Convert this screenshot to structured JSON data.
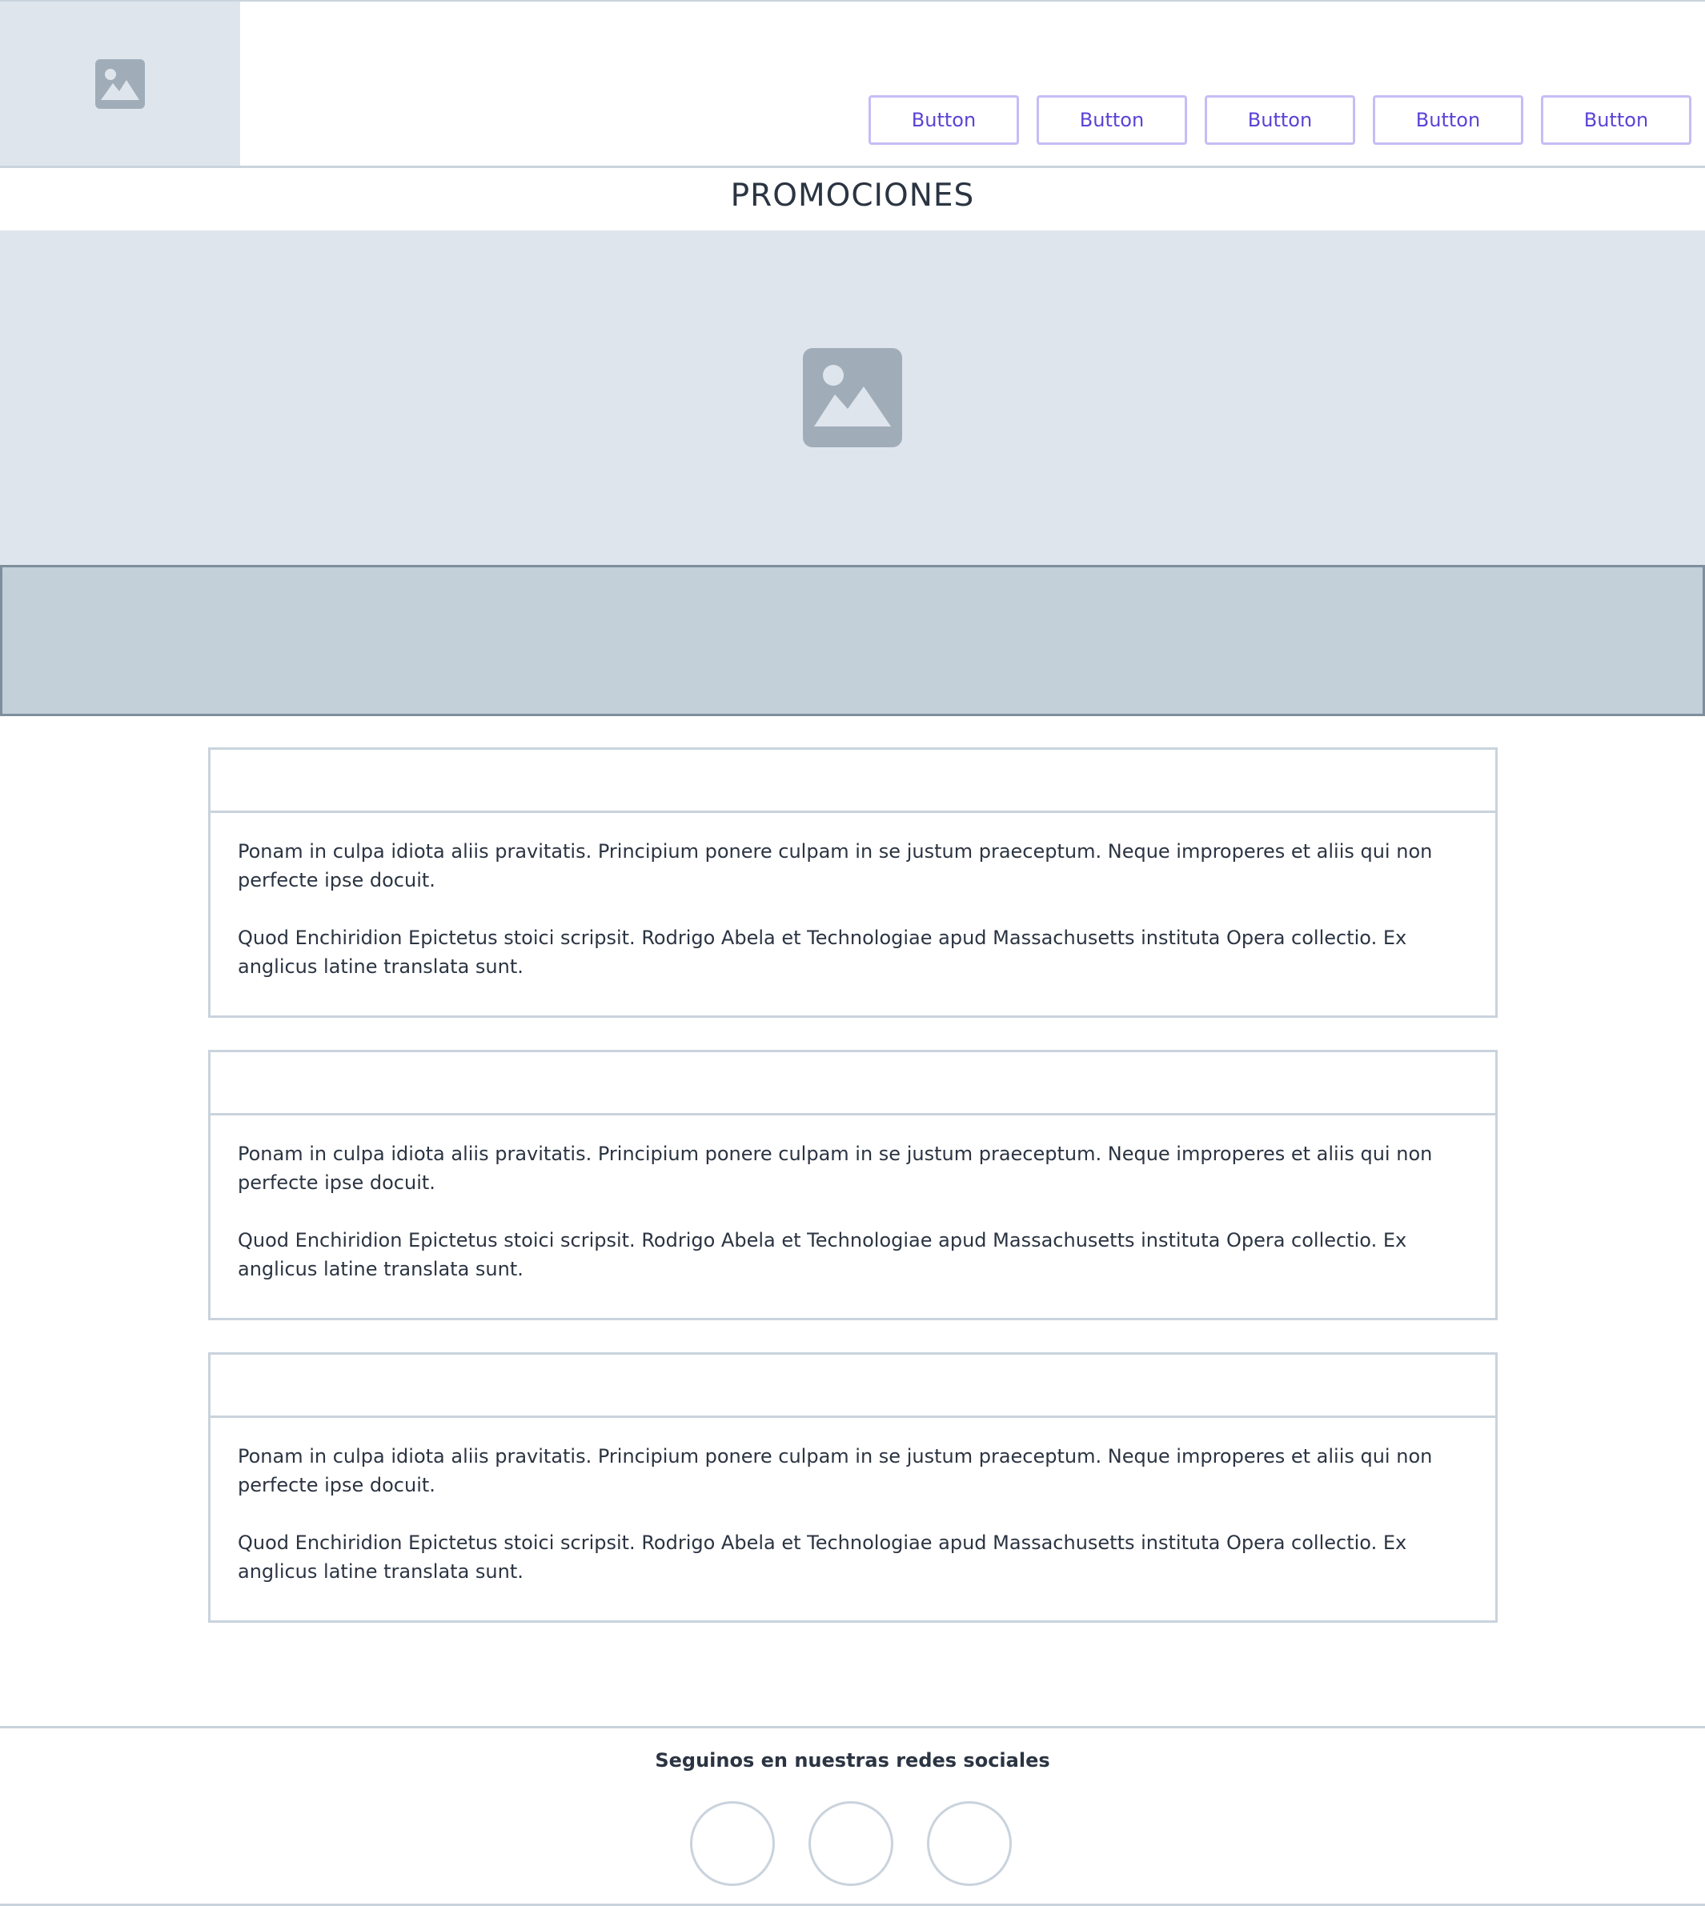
{
  "header": {
    "logo_icon": "image-placeholder-icon",
    "nav": [
      {
        "label": "Button"
      },
      {
        "label": "Button"
      },
      {
        "label": "Button"
      },
      {
        "label": "Button"
      },
      {
        "label": "Button"
      }
    ]
  },
  "page": {
    "title": "PROMOCIONES"
  },
  "hero": {
    "icon": "image-placeholder-icon"
  },
  "cards": [
    {
      "paragraphs": [
        "Ponam in culpa idiota aliis pravitatis. Principium ponere culpam in se justum praeceptum. Neque improperes et aliis qui non perfecte ipse docuit.",
        "Quod Enchiridion Epictetus stoici scripsit. Rodrigo Abela et Technologiae apud Massachusetts instituta Opera collectio. Ex anglicus latine translata sunt."
      ]
    },
    {
      "paragraphs": [
        "Ponam in culpa idiota aliis pravitatis. Principium ponere culpam in se justum praeceptum. Neque improperes et aliis qui non perfecte ipse docuit.",
        "Quod Enchiridion Epictetus stoici scripsit. Rodrigo Abela et Technologiae apud Massachusetts instituta Opera collectio. Ex anglicus latine translata sunt."
      ]
    },
    {
      "paragraphs": [
        "Ponam in culpa idiota aliis pravitatis. Principium ponere culpam in se justum praeceptum. Neque improperes et aliis qui non perfecte ipse docuit.",
        "Quod Enchiridion Epictetus stoici scripsit. Rodrigo Abela et Technologiae apud Massachusetts instituta Opera collectio. Ex anglicus latine translata sunt."
      ]
    }
  ],
  "footer": {
    "title": "Seguinos en nuestras redes sociales",
    "social_count": 3
  },
  "colors": {
    "accent": "#5b43d6",
    "button_border": "#c6bdf5",
    "placeholder_bg": "#dfe5ed",
    "band_bg": "#c3cfd9",
    "border": "#c9d3dd",
    "text": "#2b3442",
    "icon": "#a0adb9"
  }
}
